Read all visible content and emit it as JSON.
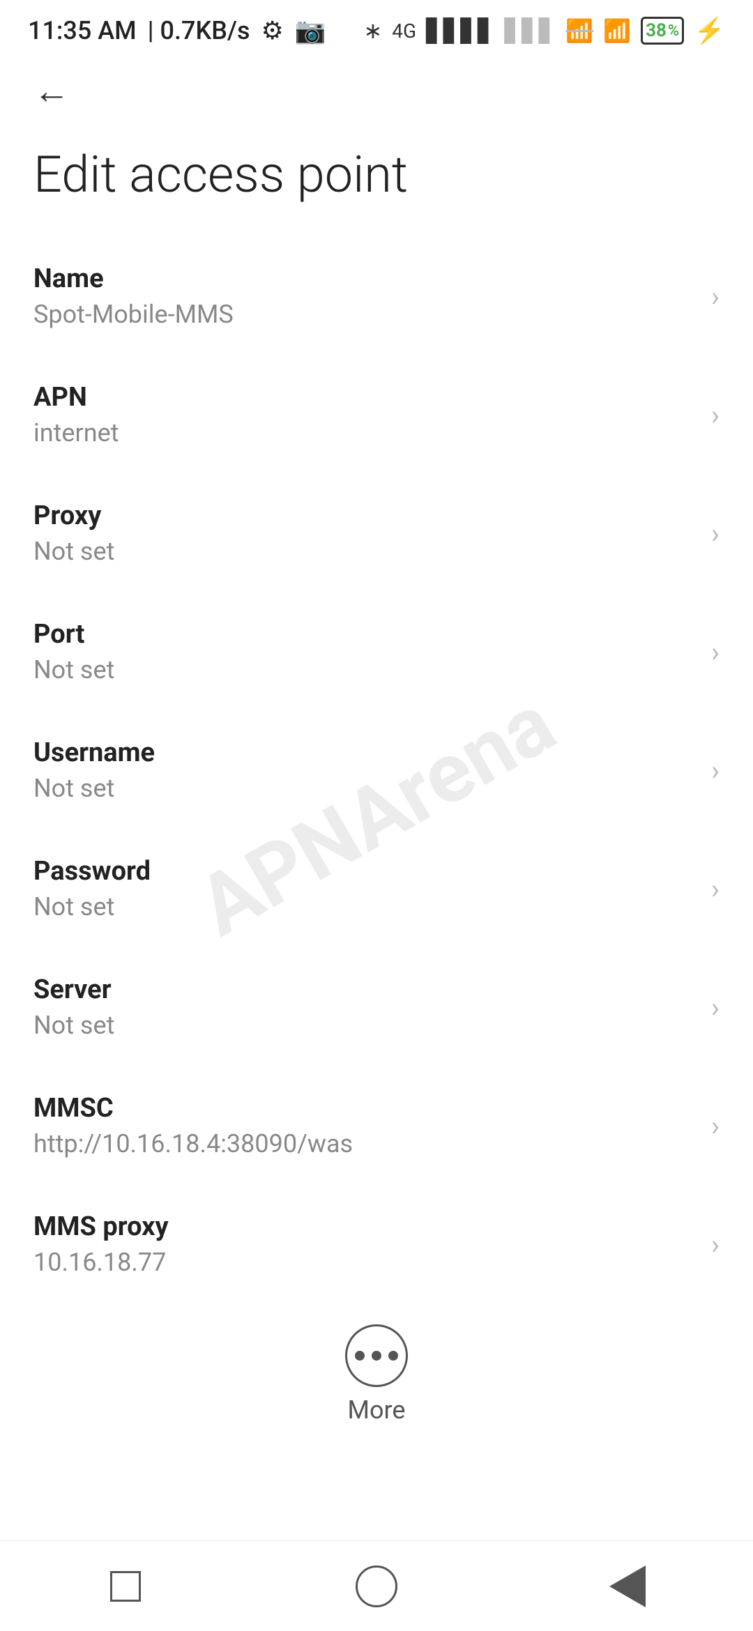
{
  "status_bar": {
    "time": "11:35 AM",
    "speed": "0.7KB/s"
  },
  "header": {
    "back_label": "←"
  },
  "page": {
    "title": "Edit access point"
  },
  "settings_items": [
    {
      "label": "Name",
      "value": "Spot-Mobile-MMS"
    },
    {
      "label": "APN",
      "value": "internet"
    },
    {
      "label": "Proxy",
      "value": "Not set"
    },
    {
      "label": "Port",
      "value": "Not set"
    },
    {
      "label": "Username",
      "value": "Not set"
    },
    {
      "label": "Password",
      "value": "Not set"
    },
    {
      "label": "Server",
      "value": "Not set"
    },
    {
      "label": "MMSC",
      "value": "http://10.16.18.4:38090/was"
    },
    {
      "label": "MMS proxy",
      "value": "10.16.18.77"
    }
  ],
  "more": {
    "label": "More"
  },
  "watermark": {
    "text": "APNArena"
  }
}
